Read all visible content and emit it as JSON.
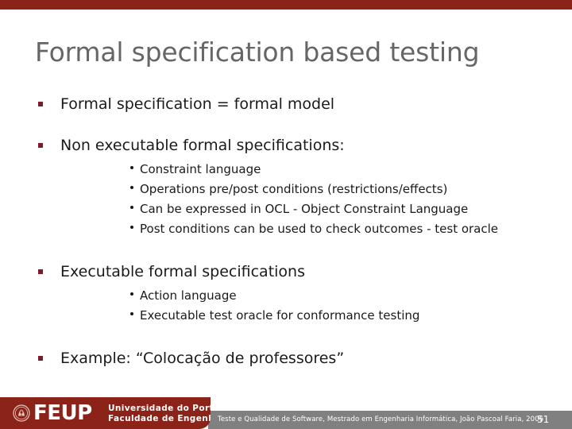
{
  "theme": {
    "accent_color": "#8C2318",
    "bullet_color": "#7B1B2B",
    "title_color": "#666666",
    "footer_bar_color": "#808080",
    "body_color": "#1a1a1a"
  },
  "slide": {
    "title": "Formal specification based testing",
    "bullets": [
      {
        "text": "Formal specification = formal model",
        "sub": []
      },
      {
        "text": "Non executable formal specifications:",
        "sub": [
          "Constraint language",
          "Operations pre/post conditions (restrictions/effects)",
          "Can be expressed in OCL - Object Constraint Language",
          "Post conditions can be used to check outcomes - test oracle"
        ]
      },
      {
        "text": "Executable formal specifications",
        "sub": [
          "Action language",
          "Executable test oracle for conformance testing"
        ]
      },
      {
        "text": "Example: “Colocação de professores”",
        "sub": []
      }
    ]
  },
  "footer": {
    "text": "Teste e Qualidade de Software, Mestrado em Engenharia Informática, João Pascoal Faria, 2006",
    "page_number": "51"
  },
  "logo": {
    "acronym": "FEUP",
    "line1": "Universidade do Porto",
    "line2": "Faculdade de Engenharia",
    "seal_icon": "feup-seal-icon"
  }
}
